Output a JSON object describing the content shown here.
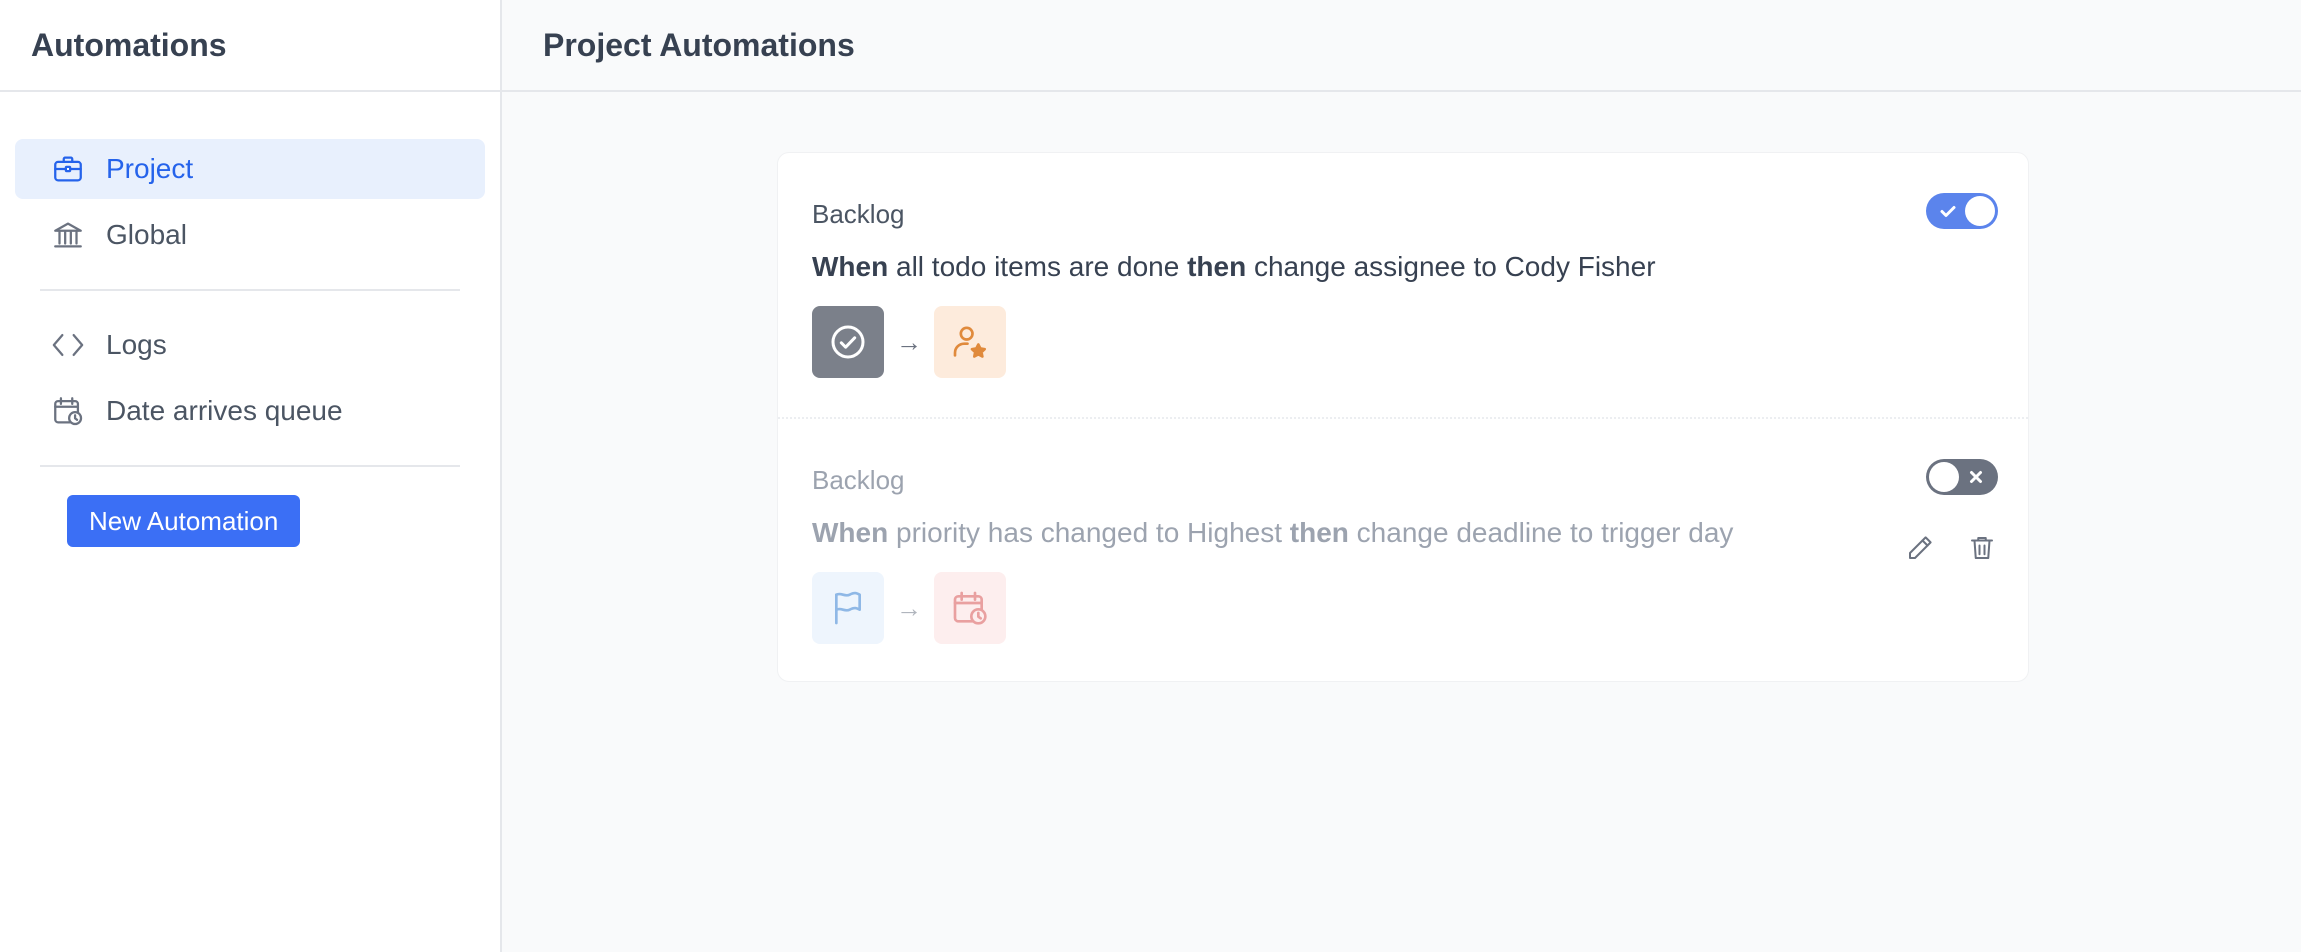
{
  "sidebar": {
    "title": "Automations",
    "items": [
      {
        "label": "Project",
        "icon": "briefcase-icon",
        "active": true
      },
      {
        "label": "Global",
        "icon": "bank-icon",
        "active": false
      },
      {
        "label": "Logs",
        "icon": "code-icon",
        "active": false
      },
      {
        "label": "Date arrives queue",
        "icon": "calendar-clock-icon",
        "active": false
      }
    ],
    "new_button_label": "New Automation"
  },
  "main": {
    "title": "Project Automations",
    "automations": [
      {
        "label": "Backlog",
        "when_word": "When",
        "trigger": "all todo items are done",
        "then_word": "then",
        "action": "change assignee to Cody Fisher",
        "enabled": true,
        "trigger_icon": "check-circle-icon",
        "action_icon": "user-star-icon",
        "arrow": "→"
      },
      {
        "label": "Backlog",
        "when_word": "When",
        "trigger": "priority has changed to Highest",
        "then_word": "then",
        "action": "change deadline to trigger day",
        "enabled": false,
        "trigger_icon": "flag-icon",
        "action_icon": "calendar-clock-icon",
        "arrow": "→"
      }
    ]
  },
  "colors": {
    "accent": "#3b6ff5",
    "active_nav_bg": "#e8f0fd",
    "toggle_on": "#5b84ec",
    "toggle_off": "#6b7280"
  }
}
